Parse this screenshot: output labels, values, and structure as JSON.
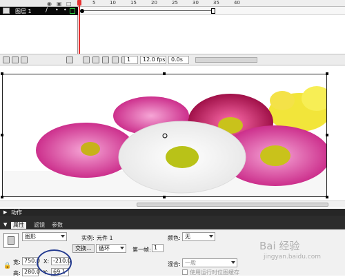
{
  "timeline": {
    "layer_name": "图层 1",
    "ruler_ticks": [
      "5",
      "10",
      "15",
      "20",
      "25",
      "30",
      "35",
      "40"
    ],
    "frame_number": "1",
    "fps": "12.0 fps",
    "elapsed": "0.0s"
  },
  "stage": {
    "image": "flower-bouquet-image"
  },
  "panels": {
    "actions_label": "动作",
    "tabs": [
      "属性",
      "滤镜",
      "参数"
    ]
  },
  "properties": {
    "symbol_type": "图形",
    "instance_label": "实例:",
    "instance_name": "元件 1",
    "swap_button": "交换...",
    "loop_option": "循环",
    "first_frame_label": "第一帧:",
    "first_frame_value": "1",
    "color_label": "颜色:",
    "color_value": "无",
    "blend_label": "混合:",
    "blend_value": "一般",
    "cache_checkbox": "使用运行时位图缓存",
    "width_label": "宽:",
    "width_value": "750.0",
    "height_label": "高:",
    "height_value": "280.0",
    "x_label": "X:",
    "x_value": "-210.0",
    "y_label": "Y:",
    "y_value": "69.1"
  },
  "watermark": {
    "text": "Bai 经验",
    "sub": "jingyan.baidu.com"
  }
}
